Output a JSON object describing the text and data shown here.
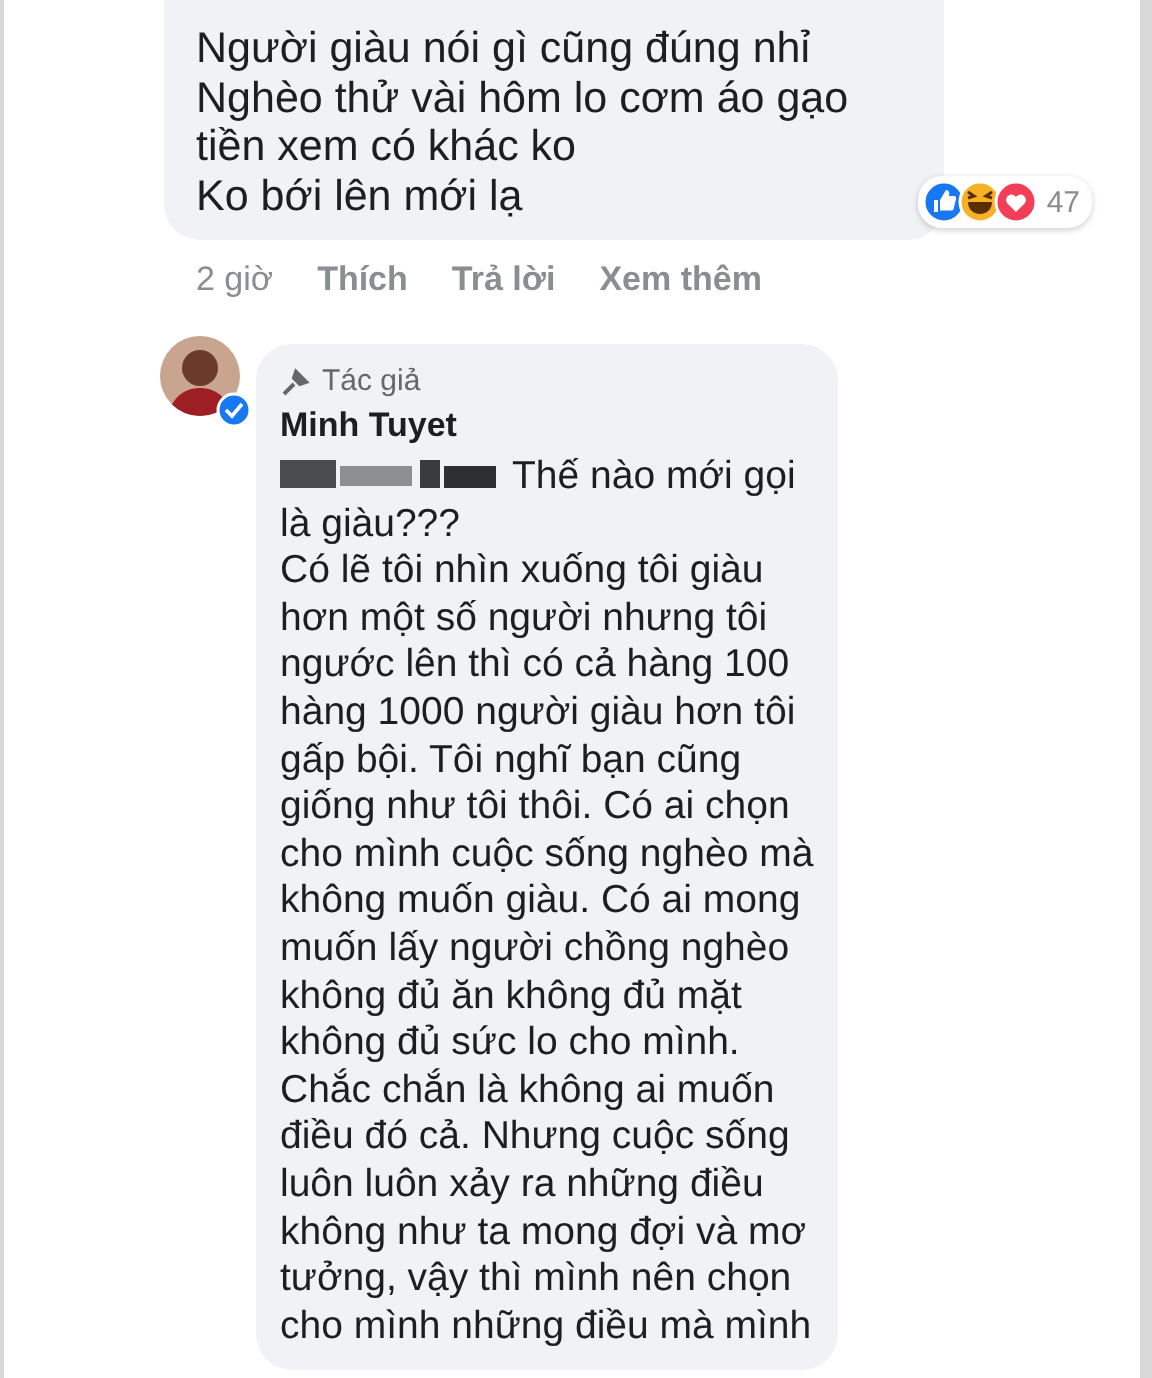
{
  "comments": [
    {
      "kind": "reply",
      "text": "Người giàu nói gì cũng đúng nhỉ\nNghèo thử vài hôm lo cơm áo gạo\ntiền xem có khác ko\nKo bới lên mới lạ",
      "reaction_count": "47",
      "actions": [
        "2 giờ",
        "Thích",
        "Trả lời",
        "Xem thêm"
      ]
    },
    {
      "kind": "author",
      "badge": "Tác giả",
      "author": "Minh Tuyet",
      "verified": true,
      "text": "Thế nào mới gọi\nlà giàu???\nCó lẽ tôi nhìn xuống tôi giàu\nhơn một số người nhưng tôi\nngước lên thì có cả hàng 100\nhàng 1000 người giàu hơn tôi\ngấp bội. Tôi nghĩ bạn cũng\ngiống như tôi thôi. Có ai chọn\ncho mình cuộc sống nghèo mà\nkhông muốn giàu. Có ai mong\nmuốn lấy người chồng nghèo\nkhông đủ ăn không đủ mặt\nkhông đủ sức lo cho mình.\nChắc chắn là không ai muốn\nđiều đó cả. Nhưng cuộc sống\nluôn luôn xảy ra những điều\nkhông như ta mong đợi và mơ\ntưởng, vậy thì mình nên chọn\ncho mình những điều mà mình"
    }
  ]
}
